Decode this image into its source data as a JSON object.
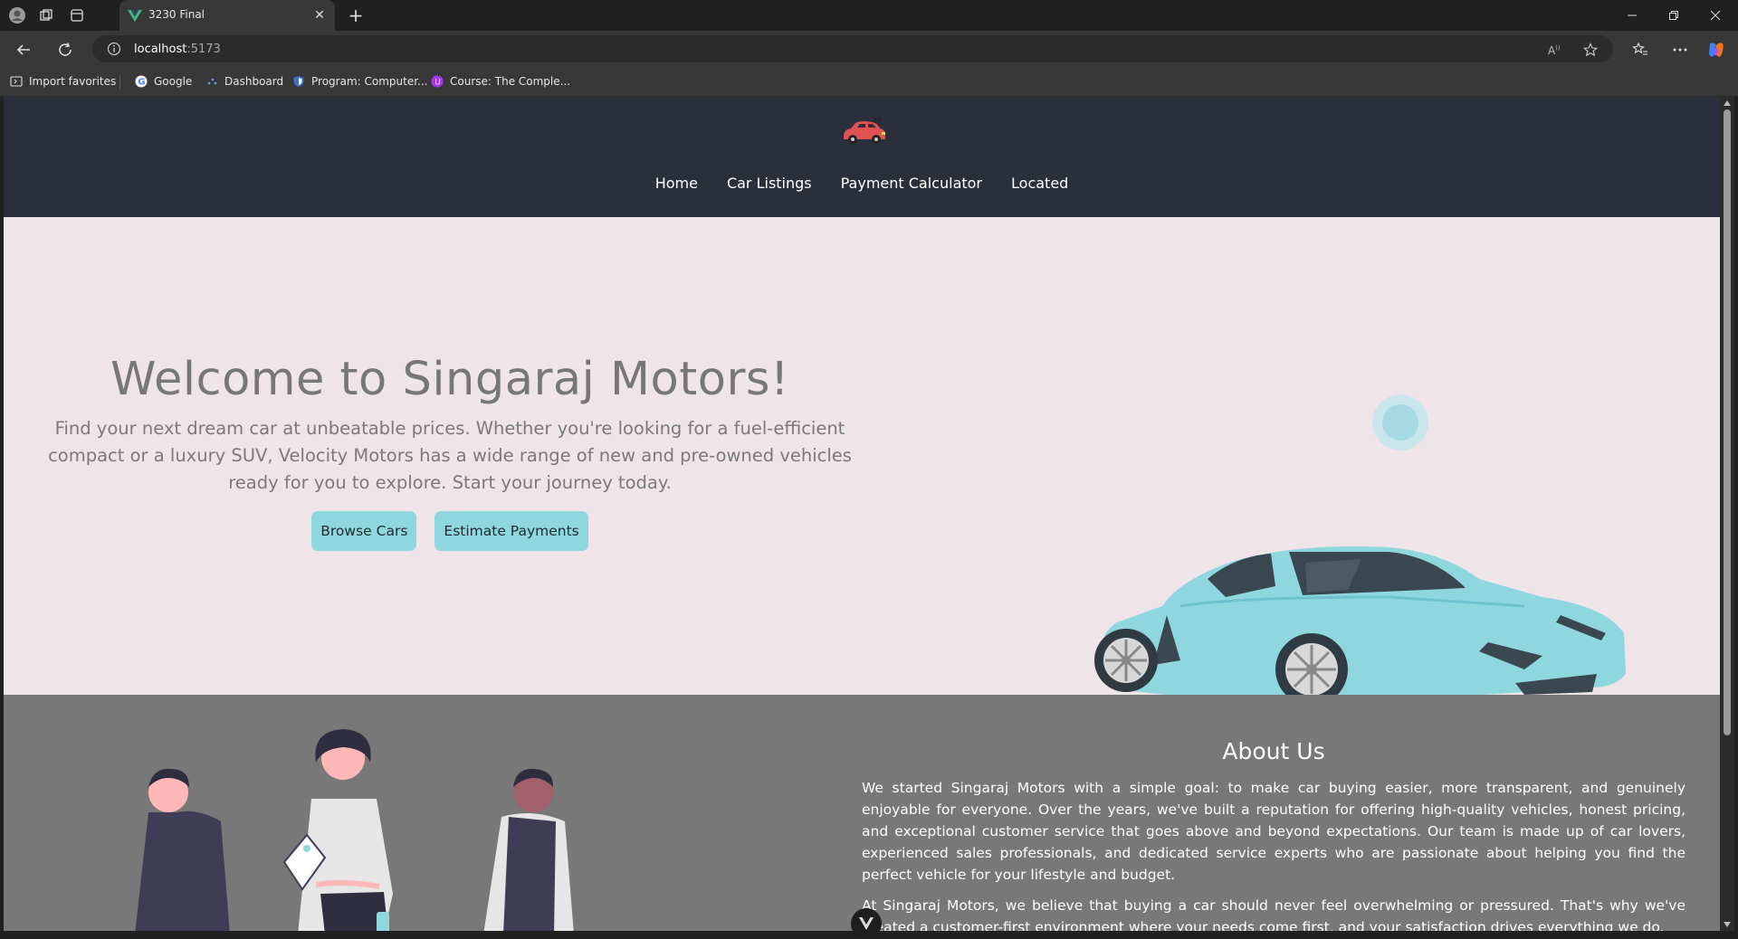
{
  "browser": {
    "tab_title": "3230 Final",
    "url_host": "localhost",
    "url_port": ":5173",
    "bookmarks": [
      "Import favorites",
      "Google",
      "Dashboard",
      "Program: Computer...",
      "Course: The Comple..."
    ]
  },
  "site": {
    "nav": [
      "Home",
      "Car Listings",
      "Payment Calculator",
      "Located"
    ],
    "hero": {
      "title": "Welcome to Singaraj Motors!",
      "subtitle": "Find your next dream car at unbeatable prices. Whether you're looking for a fuel-efficient compact or a luxury SUV, Velocity Motors has a wide range of new and pre-owned vehicles ready for you to explore. Start your journey today.",
      "browse_label": "Browse Cars",
      "estimate_label": "Estimate Payments"
    },
    "about": {
      "title": "About Us",
      "p1": "We started Singaraj Motors with a simple goal: to make car buying easier, more transparent, and genuinely enjoyable for everyone. Over the years, we've built a reputation for offering high-quality vehicles, honest pricing, and exceptional customer service that goes above and beyond expectations. Our team is made up of car lovers, experienced sales professionals, and dedicated service experts who are passionate about helping you find the perfect vehicle for your lifestyle and budget.",
      "p2": "At Singaraj Motors, we believe that buying a car should never feel overwhelming or pressured. That's why we've created a customer-first environment where your needs come first, and your satisfaction drives everything we do."
    }
  },
  "colors": {
    "header_bg": "#2a2f3b",
    "hero_bg": "#efe4e8",
    "button_bg": "#8fd7df",
    "about_bg": "#787878",
    "car_body": "#8fd7df"
  }
}
